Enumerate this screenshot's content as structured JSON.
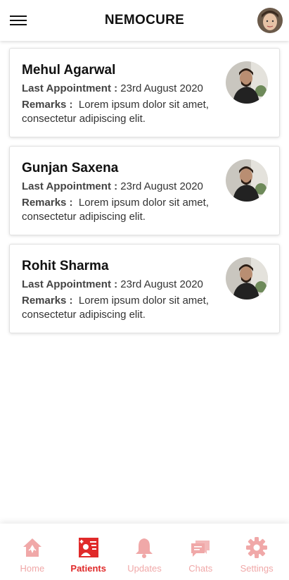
{
  "header": {
    "title": "NEMOCURE"
  },
  "patients": [
    {
      "name": "Mehul Agarwal",
      "appointment_label": "Last Appointment :",
      "appointment_date": "23rd August 2020",
      "remarks_label": "Remarks :",
      "remarks_text": "Lorem ipsum dolor sit amet, consectetur adipiscing elit."
    },
    {
      "name": "Gunjan Saxena",
      "appointment_label": "Last Appointment :",
      "appointment_date": "23rd August 2020",
      "remarks_label": "Remarks :",
      "remarks_text": "Lorem ipsum dolor sit amet, consectetur adipiscing elit."
    },
    {
      "name": "Rohit Sharma",
      "appointment_label": "Last Appointment :",
      "appointment_date": "23rd August 2020",
      "remarks_label": "Remarks :",
      "remarks_text": "Lorem ipsum dolor sit amet, consectetur adipiscing elit."
    }
  ],
  "nav": {
    "items": [
      {
        "label": "Home",
        "icon": "home-icon"
      },
      {
        "label": "Patients",
        "icon": "patients-icon",
        "active": true
      },
      {
        "label": "Updates",
        "icon": "bell-icon"
      },
      {
        "label": "Chats",
        "icon": "chat-icon"
      },
      {
        "label": "Settings",
        "icon": "gear-icon"
      }
    ]
  },
  "colors": {
    "accent": "#e02a2a",
    "inactive": "#f0a8a8"
  }
}
